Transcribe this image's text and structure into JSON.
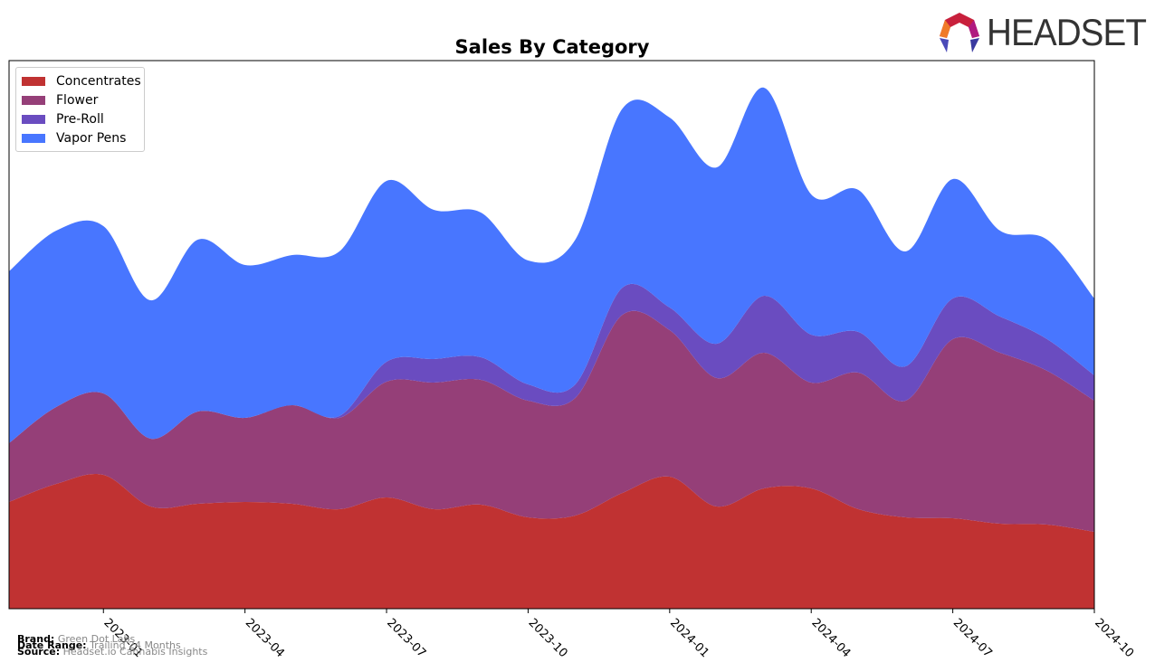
{
  "chart_data": {
    "type": "area",
    "stacked": true,
    "title": "Sales By Category",
    "x": [
      "2022-11",
      "2022-12",
      "2023-01",
      "2023-02",
      "2023-03",
      "2023-04",
      "2023-05",
      "2023-06",
      "2023-07",
      "2023-08",
      "2023-09",
      "2023-10",
      "2023-11",
      "2023-12",
      "2024-01",
      "2024-02",
      "2024-03",
      "2024-04",
      "2024-05",
      "2024-06",
      "2024-07",
      "2024-08",
      "2024-09",
      "2024-10"
    ],
    "xticks": [
      "2023-01",
      "2023-04",
      "2023-07",
      "2023-10",
      "2024-01",
      "2024-04",
      "2024-07",
      "2024-10"
    ],
    "ylim": [
      0,
      606
    ],
    "yaxis_labels": false,
    "grid": false,
    "legend_position": "top-left",
    "series": [
      {
        "name": "Concentrates",
        "color": "#c03232",
        "values": [
          118,
          138,
          148,
          113,
          116,
          118,
          116,
          110,
          123,
          110,
          115,
          101,
          103,
          128,
          146,
          113,
          133,
          133,
          110,
          101,
          100,
          94,
          93,
          85
        ]
      },
      {
        "name": "Flower",
        "color": "#953f78",
        "values": [
          65,
          85,
          90,
          75,
          102,
          93,
          109,
          101,
          128,
          140,
          138,
          129,
          130,
          197,
          162,
          142,
          150,
          117,
          151,
          129,
          198,
          189,
          170,
          145
        ]
      },
      {
        "name": "Pre-Roll",
        "color": "#6a4cc0",
        "values": [
          0,
          0,
          0,
          0,
          0,
          0,
          0,
          2,
          22,
          26,
          25,
          18,
          15,
          30,
          25,
          38,
          63,
          53,
          45,
          38,
          45,
          40,
          35,
          28
        ]
      },
      {
        "name": "Vapor Pens",
        "color": "#4876ff",
        "values": [
          190,
          195,
          185,
          153,
          190,
          169,
          166,
          182,
          200,
          165,
          160,
          137,
          160,
          198,
          210,
          195,
          230,
          155,
          157,
          127,
          132,
          95,
          110,
          85
        ]
      }
    ]
  },
  "footer": {
    "brand_label": "Brand:",
    "brand": "Green Dot Labs",
    "range_label": "Date Range:",
    "range": "Trailing 24 Months",
    "source_label": "Source:",
    "source": "Headset.io Cannabis Insights"
  },
  "logo": {
    "text": "HEADSET"
  }
}
